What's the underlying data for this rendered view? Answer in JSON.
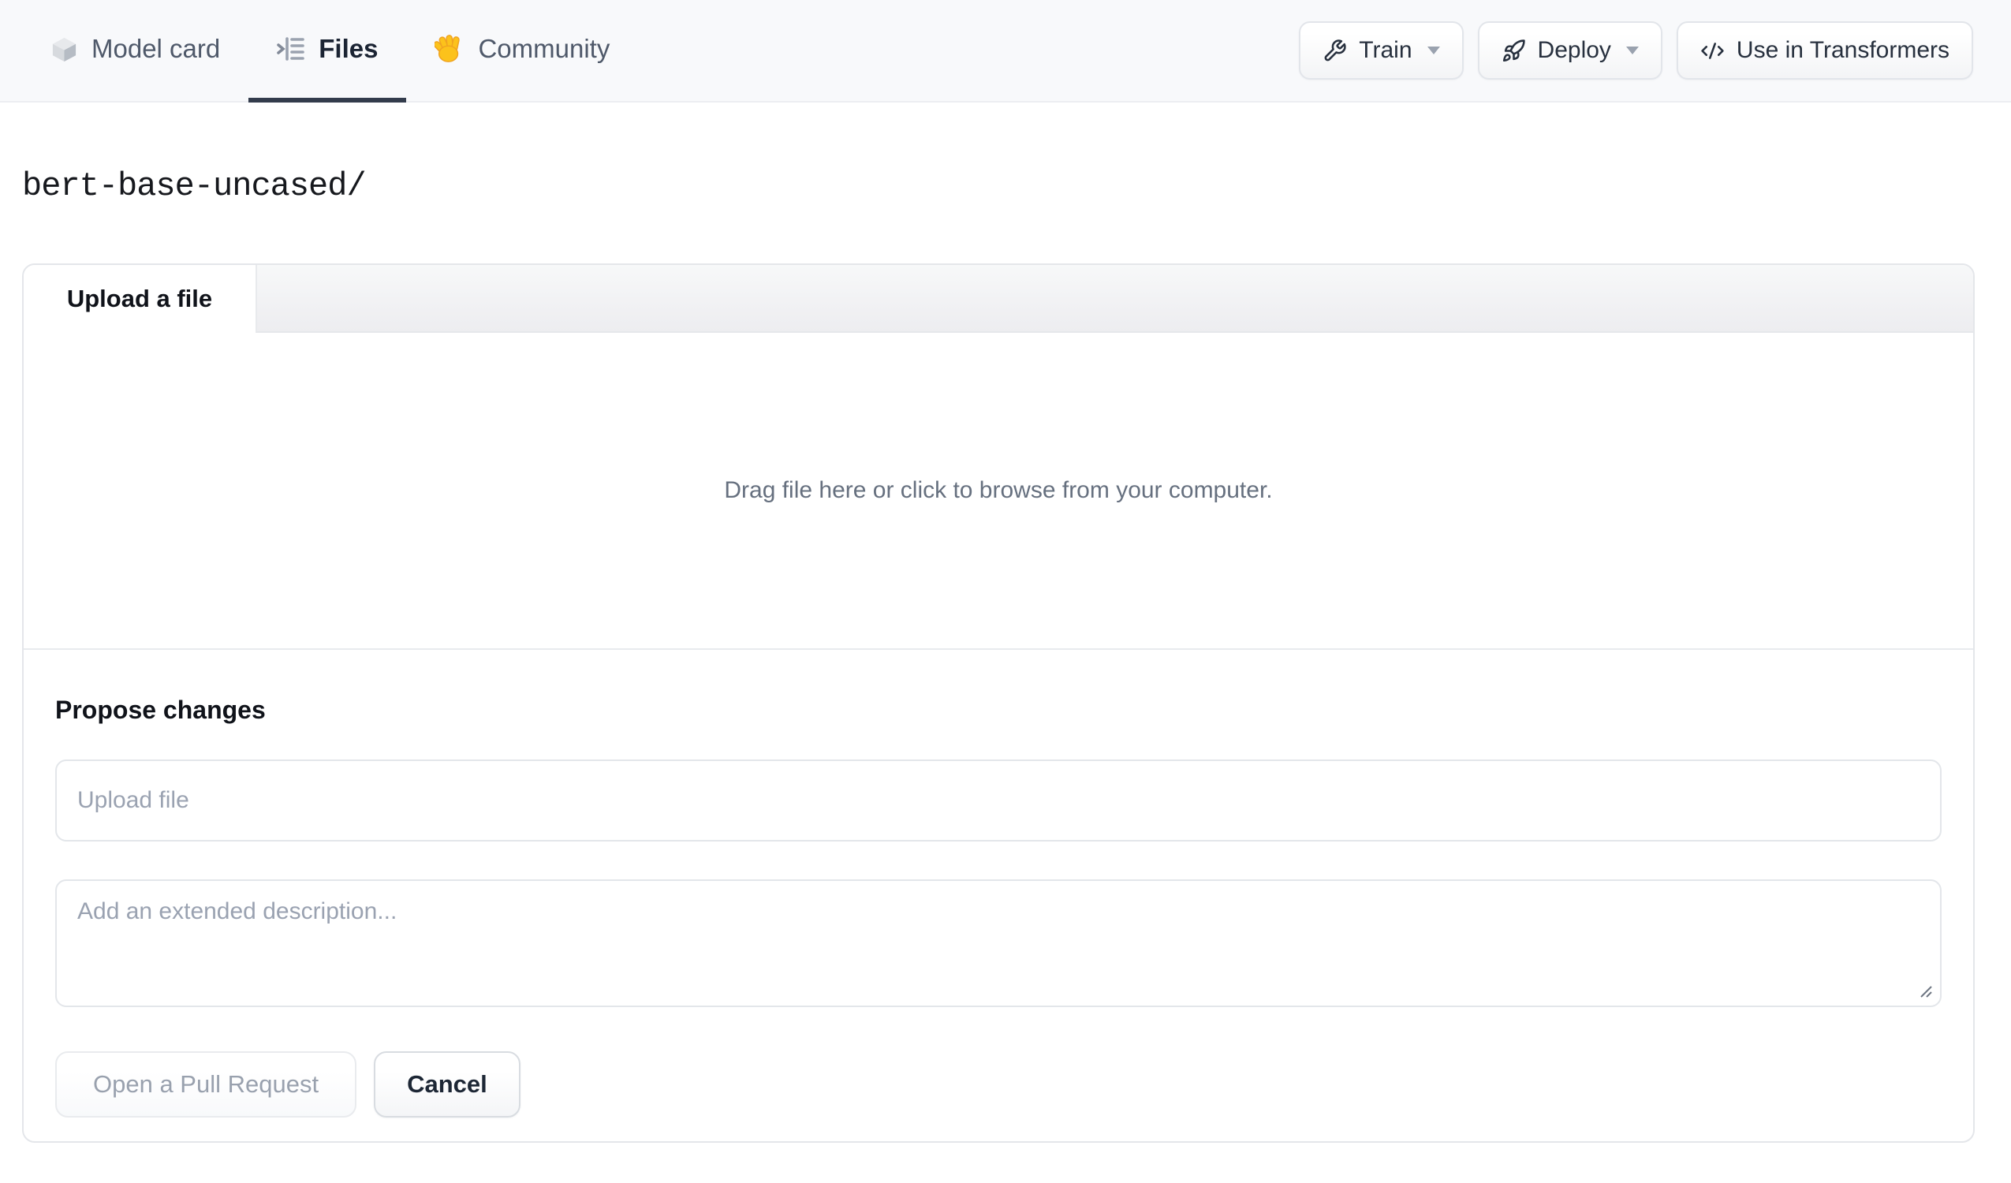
{
  "nav": {
    "tabs": [
      {
        "label": "Model card",
        "icon": "cube-icon",
        "active": false
      },
      {
        "label": "Files",
        "icon": "file-versions-icon",
        "active": true
      },
      {
        "label": "Community",
        "icon": "waving-hand-icon",
        "active": false
      }
    ],
    "actions": [
      {
        "label": "Train",
        "icon": "wrench-icon",
        "has_caret": true
      },
      {
        "label": "Deploy",
        "icon": "rocket-icon",
        "has_caret": true
      },
      {
        "label": "Use in Transformers",
        "icon": "code-icon",
        "has_caret": false
      }
    ]
  },
  "repo": {
    "path": "bert-base-uncased/"
  },
  "upload": {
    "tab_label": "Upload a file",
    "dropzone_text": "Drag file here or click to browse from your computer.",
    "propose_heading": "Propose changes",
    "file_placeholder": "Upload file",
    "description_placeholder": "Add an extended description...",
    "open_pr_label": "Open a Pull Request",
    "cancel_label": "Cancel"
  },
  "colors": {
    "nav_background": "#f8f9fb",
    "active_tab_underline": "#333c4c",
    "card_border": "#e4e6ea",
    "placeholder_text": "#9aa2b1",
    "disabled_button_text": "#99a1ae",
    "dropzone_text": "#66707f"
  }
}
